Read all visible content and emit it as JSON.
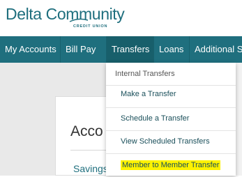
{
  "brand": {
    "name": "Delta Community",
    "tagline": "CREDIT UNION",
    "color": "#1f6f7e"
  },
  "nav": {
    "items": [
      {
        "label": "My Accounts"
      },
      {
        "label": "Bill Pay"
      },
      {
        "label": "Transfers"
      },
      {
        "label": "Loans"
      },
      {
        "label": "Additional S"
      }
    ],
    "active": "Transfers"
  },
  "dropdown": {
    "header": "Internal Transfers",
    "items": [
      {
        "label": "Make a Transfer"
      },
      {
        "label": "Schedule a Transfer"
      },
      {
        "label": "View Scheduled Transfers"
      },
      {
        "label": "Member to Member Transfer"
      }
    ],
    "highlight_color": "#fdf200"
  },
  "card": {
    "title": "Acco",
    "item": "Savings"
  }
}
